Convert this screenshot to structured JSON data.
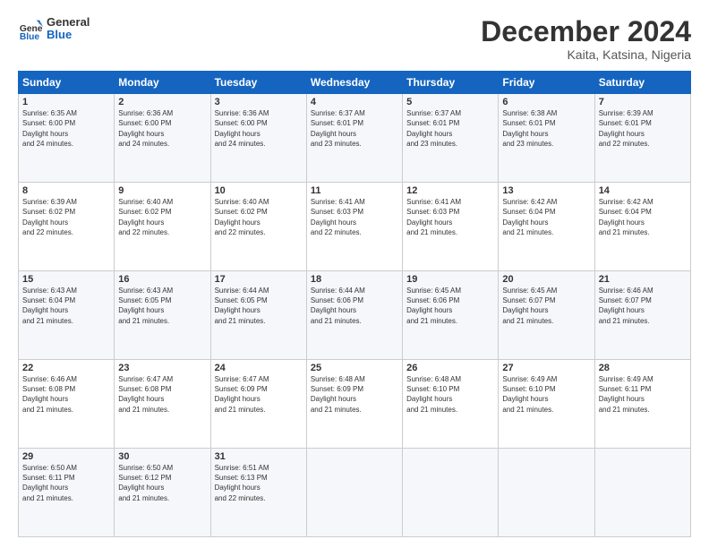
{
  "header": {
    "logo": {
      "general": "General",
      "blue": "Blue"
    },
    "month_title": "December 2024",
    "location": "Kaita, Katsina, Nigeria"
  },
  "calendar": {
    "days_of_week": [
      "Sunday",
      "Monday",
      "Tuesday",
      "Wednesday",
      "Thursday",
      "Friday",
      "Saturday"
    ],
    "weeks": [
      [
        {
          "day": "1",
          "sunrise": "6:35 AM",
          "sunset": "6:00 PM",
          "daylight": "11 hours and 24 minutes"
        },
        {
          "day": "2",
          "sunrise": "6:36 AM",
          "sunset": "6:00 PM",
          "daylight": "11 hours and 24 minutes"
        },
        {
          "day": "3",
          "sunrise": "6:36 AM",
          "sunset": "6:00 PM",
          "daylight": "11 hours and 24 minutes"
        },
        {
          "day": "4",
          "sunrise": "6:37 AM",
          "sunset": "6:01 PM",
          "daylight": "11 hours and 23 minutes"
        },
        {
          "day": "5",
          "sunrise": "6:37 AM",
          "sunset": "6:01 PM",
          "daylight": "11 hours and 23 minutes"
        },
        {
          "day": "6",
          "sunrise": "6:38 AM",
          "sunset": "6:01 PM",
          "daylight": "11 hours and 23 minutes"
        },
        {
          "day": "7",
          "sunrise": "6:39 AM",
          "sunset": "6:01 PM",
          "daylight": "11 hours and 22 minutes"
        }
      ],
      [
        {
          "day": "8",
          "sunrise": "6:39 AM",
          "sunset": "6:02 PM",
          "daylight": "11 hours and 22 minutes"
        },
        {
          "day": "9",
          "sunrise": "6:40 AM",
          "sunset": "6:02 PM",
          "daylight": "11 hours and 22 minutes"
        },
        {
          "day": "10",
          "sunrise": "6:40 AM",
          "sunset": "6:02 PM",
          "daylight": "11 hours and 22 minutes"
        },
        {
          "day": "11",
          "sunrise": "6:41 AM",
          "sunset": "6:03 PM",
          "daylight": "11 hours and 22 minutes"
        },
        {
          "day": "12",
          "sunrise": "6:41 AM",
          "sunset": "6:03 PM",
          "daylight": "11 hours and 21 minutes"
        },
        {
          "day": "13",
          "sunrise": "6:42 AM",
          "sunset": "6:04 PM",
          "daylight": "11 hours and 21 minutes"
        },
        {
          "day": "14",
          "sunrise": "6:42 AM",
          "sunset": "6:04 PM",
          "daylight": "11 hours and 21 minutes"
        }
      ],
      [
        {
          "day": "15",
          "sunrise": "6:43 AM",
          "sunset": "6:04 PM",
          "daylight": "11 hours and 21 minutes"
        },
        {
          "day": "16",
          "sunrise": "6:43 AM",
          "sunset": "6:05 PM",
          "daylight": "11 hours and 21 minutes"
        },
        {
          "day": "17",
          "sunrise": "6:44 AM",
          "sunset": "6:05 PM",
          "daylight": "11 hours and 21 minutes"
        },
        {
          "day": "18",
          "sunrise": "6:44 AM",
          "sunset": "6:06 PM",
          "daylight": "11 hours and 21 minutes"
        },
        {
          "day": "19",
          "sunrise": "6:45 AM",
          "sunset": "6:06 PM",
          "daylight": "11 hours and 21 minutes"
        },
        {
          "day": "20",
          "sunrise": "6:45 AM",
          "sunset": "6:07 PM",
          "daylight": "11 hours and 21 minutes"
        },
        {
          "day": "21",
          "sunrise": "6:46 AM",
          "sunset": "6:07 PM",
          "daylight": "11 hours and 21 minutes"
        }
      ],
      [
        {
          "day": "22",
          "sunrise": "6:46 AM",
          "sunset": "6:08 PM",
          "daylight": "11 hours and 21 minutes"
        },
        {
          "day": "23",
          "sunrise": "6:47 AM",
          "sunset": "6:08 PM",
          "daylight": "11 hours and 21 minutes"
        },
        {
          "day": "24",
          "sunrise": "6:47 AM",
          "sunset": "6:09 PM",
          "daylight": "11 hours and 21 minutes"
        },
        {
          "day": "25",
          "sunrise": "6:48 AM",
          "sunset": "6:09 PM",
          "daylight": "11 hours and 21 minutes"
        },
        {
          "day": "26",
          "sunrise": "6:48 AM",
          "sunset": "6:10 PM",
          "daylight": "11 hours and 21 minutes"
        },
        {
          "day": "27",
          "sunrise": "6:49 AM",
          "sunset": "6:10 PM",
          "daylight": "11 hours and 21 minutes"
        },
        {
          "day": "28",
          "sunrise": "6:49 AM",
          "sunset": "6:11 PM",
          "daylight": "11 hours and 21 minutes"
        }
      ],
      [
        {
          "day": "29",
          "sunrise": "6:50 AM",
          "sunset": "6:11 PM",
          "daylight": "11 hours and 21 minutes"
        },
        {
          "day": "30",
          "sunrise": "6:50 AM",
          "sunset": "6:12 PM",
          "daylight": "11 hours and 21 minutes"
        },
        {
          "day": "31",
          "sunrise": "6:51 AM",
          "sunset": "6:13 PM",
          "daylight": "11 hours and 22 minutes"
        },
        null,
        null,
        null,
        null
      ]
    ]
  }
}
